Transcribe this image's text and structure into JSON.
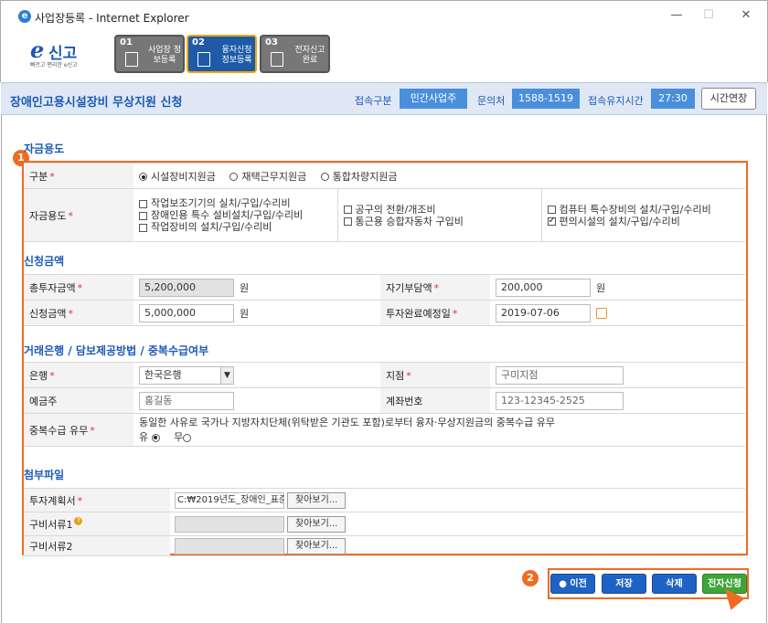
{
  "window": {
    "title": "사업장등록 - Internet Explorer",
    "min": "—",
    "max": "☐",
    "close": "✕"
  },
  "logo": {
    "main": "신고",
    "tagline": "빠르고 편리한 e신고"
  },
  "steps": [
    {
      "num": "01",
      "label": "사업장 정보등록"
    },
    {
      "num": "02",
      "label": "융자신청 정보등록"
    },
    {
      "num": "03",
      "label": "전자신고 완료"
    }
  ],
  "topbar": {
    "page_title": "장애인고용시설장비 무상지원 신청",
    "access_type_label": "접속구분",
    "access_type_value": "민간사업주",
    "contact_label": "문의처",
    "contact_value": "1588-1519",
    "keepalive_label": "접속유지시간",
    "keepalive_value": "27:30",
    "extend_button": "시간연장"
  },
  "fund_purpose": {
    "title": "자금용도",
    "type_label": "구분",
    "type_options": [
      "시설장비지원금",
      "재택근무지원금",
      "통합차량지원금"
    ],
    "usage_label": "자금용도",
    "col1": [
      "작업보조기기의 실치/구입/수리비",
      "장애인용 특수 설비설치/구입/수리비",
      "작업장비의 설치/구입/수리비"
    ],
    "col2": [
      "공구의 전환/개조비",
      "통근용 승합자동차 구입비"
    ],
    "col3": [
      "컴퓨터 특수장비의 설치/구입/수리비",
      "편의시설의 설치/구입/수리비"
    ]
  },
  "amount": {
    "title": "신청금액",
    "total_label": "총투자금액",
    "total_value": "5,200,000",
    "self_label": "자기부담액",
    "self_value": "200,000",
    "apply_label": "신청금액",
    "apply_value": "5,000,000",
    "completion_label": "투자완료예정일",
    "completion_value": "2019-07-06",
    "unit": "원"
  },
  "bank": {
    "title": "거래은행 / 담보제공방법 / 중복수급여부",
    "bank_label": "은행",
    "bank_value": "한국은행",
    "branch_label": "지점",
    "branch_value": "구미지점",
    "holder_label": "예금주",
    "holder_value": "홍길동",
    "account_label": "계좌번호",
    "account_value": "123-12345-2525",
    "dup_label": "중복수급 유무",
    "dup_text": "동일한 사유로 국가나 지방자치단체(위탁받은 기관도 포함)로부터 융자·무상지원금의 중복수급 유무",
    "dup_yes": "유",
    "dup_no": "무"
  },
  "files": {
    "title": "첨부파일",
    "plan_label": "투자계획서",
    "plan_value": "C:₩2019년도_장애인_표준",
    "doc1_label": "구비서류1",
    "doc2_label": "구비서류2",
    "browse": "찾아보기..."
  },
  "annotations": {
    "badge1": "1",
    "badge2": "2"
  },
  "actions": {
    "prev": "이전",
    "save": "저장",
    "delete": "삭제",
    "submit": "전자신청"
  }
}
